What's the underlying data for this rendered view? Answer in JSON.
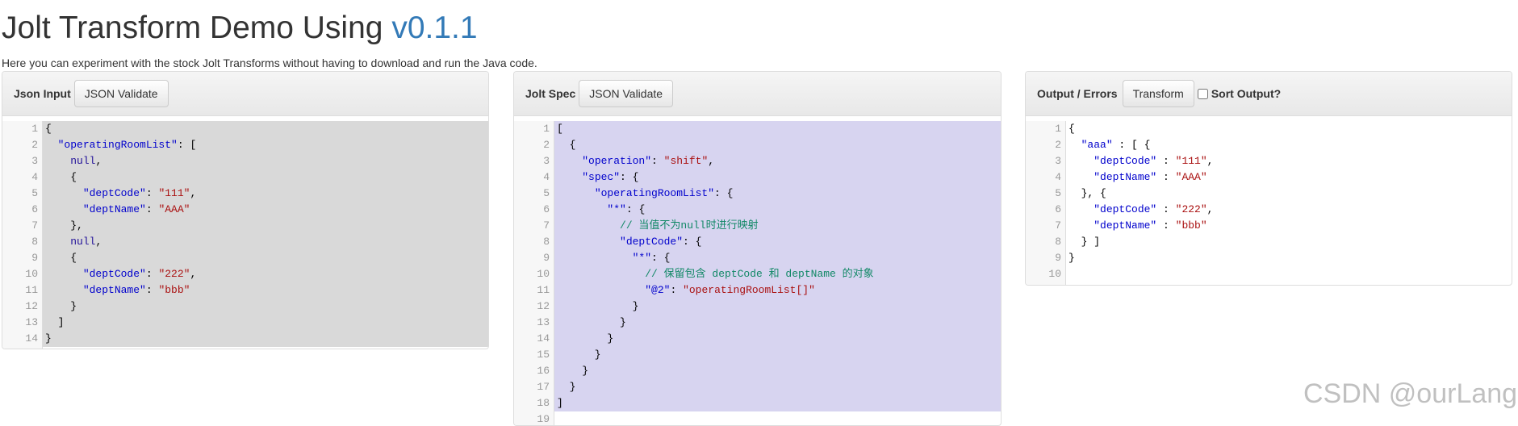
{
  "header": {
    "title_prefix": "Jolt Transform Demo Using ",
    "title_version": "v0.1.1",
    "subtitle": "Here you can experiment with the stock Jolt Transforms without having to download and run the Java code."
  },
  "input_panel": {
    "label": "Json Input",
    "validate_button": "JSON Validate",
    "line_numbers": [
      "1",
      "2",
      "3",
      "4",
      "5",
      "6",
      "7",
      "8",
      "9",
      "10",
      "11",
      "12",
      "13",
      "14"
    ],
    "lines": [
      "{",
      "  \"operatingRoomList\": [",
      "    null,",
      "    {",
      "      \"deptCode\": \"111\",",
      "      \"deptName\": \"AAA\"",
      "    },",
      "    null,",
      "    {",
      "      \"deptCode\": \"222\",",
      "      \"deptName\": \"bbb\"",
      "    }",
      "  ]",
      "}"
    ]
  },
  "spec_panel": {
    "label": "Jolt Spec",
    "validate_button": "JSON Validate",
    "line_numbers": [
      "1",
      "2",
      "3",
      "4",
      "5",
      "6",
      "7",
      "8",
      "9",
      "10",
      "11",
      "12",
      "13",
      "14",
      "15",
      "16",
      "17",
      "18",
      "19"
    ],
    "lines": [
      "[",
      "  {",
      "    \"operation\": \"shift\",",
      "    \"spec\": {",
      "      \"operatingRoomList\": {",
      "        \"*\": {",
      "          // 当值不为null时进行映射",
      "          \"deptCode\": {",
      "            \"*\": {",
      "              // 保留包含 deptCode 和 deptName 的对象",
      "              \"@2\": \"operatingRoomList[]\"",
      "            }",
      "          }",
      "        }",
      "      }",
      "    }",
      "  }",
      "]",
      ""
    ]
  },
  "output_panel": {
    "label": "Output / Errors",
    "transform_button": "Transform",
    "sort_label": "Sort Output?",
    "sort_checked": false,
    "line_numbers": [
      "1",
      "2",
      "3",
      "4",
      "5",
      "6",
      "7",
      "8",
      "9",
      "10"
    ],
    "lines": [
      "{",
      "  \"aaa\" : [ {",
      "    \"deptCode\" : \"111\",",
      "    \"deptName\" : \"AAA\"",
      "  }, {",
      "    \"deptCode\" : \"222\",",
      "    \"deptName\" : \"bbb\"",
      "  } ]",
      "}",
      ""
    ]
  },
  "watermark": "CSDN @ourLang",
  "colors": {
    "version_link": "#337ab7",
    "input_selection": "#d9d9d9",
    "spec_selection": "#d7d4f0",
    "json_key": "#0000cc",
    "comment": "#118866"
  }
}
